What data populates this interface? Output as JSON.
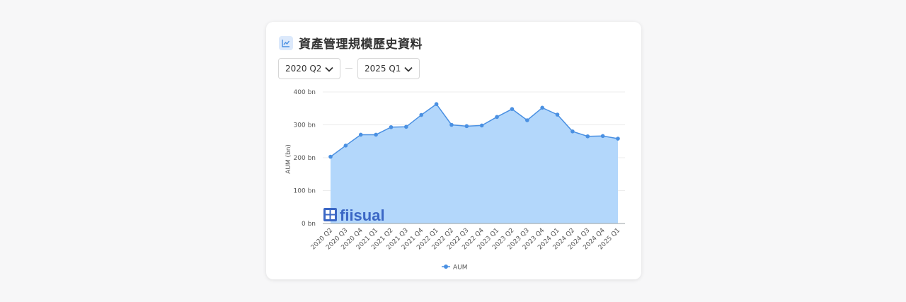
{
  "header": {
    "title": "資產管理規模歷史資料",
    "icon": "line-chart-icon"
  },
  "range": {
    "from": "2020 Q2",
    "to": "2025 Q1"
  },
  "watermark": "fiisual",
  "colors": {
    "line": "#4a90e2",
    "fill": "#b3d7fb",
    "axis": "#9aa0a6",
    "grid": "#ececec"
  },
  "chart_data": {
    "type": "area",
    "title": "資產管理規模歷史資料",
    "ylabel": "AUM (bn)",
    "xlabel": "",
    "ylim": [
      0,
      400
    ],
    "yticks": [
      0,
      100,
      200,
      300,
      400
    ],
    "ytick_labels": [
      "0 bn",
      "100 bn",
      "200 bn",
      "300 bn",
      "400 bn"
    ],
    "grid": true,
    "legend_position": "bottom",
    "categories": [
      "2020 Q2",
      "2020 Q3",
      "2020 Q4",
      "2021 Q1",
      "2021 Q2",
      "2021 Q3",
      "2021 Q4",
      "2022 Q1",
      "2022 Q2",
      "2022 Q3",
      "2022 Q4",
      "2023 Q1",
      "2023 Q2",
      "2023 Q3",
      "2023 Q4",
      "2024 Q1",
      "2024 Q2",
      "2024 Q3",
      "2024 Q4",
      "2025 Q1"
    ],
    "series": [
      {
        "name": "AUM",
        "values": [
          203,
          237,
          270,
          270,
          293,
          294,
          330,
          363,
          300,
          296,
          298,
          324,
          348,
          314,
          352,
          331,
          280,
          265,
          266,
          258
        ]
      }
    ]
  }
}
